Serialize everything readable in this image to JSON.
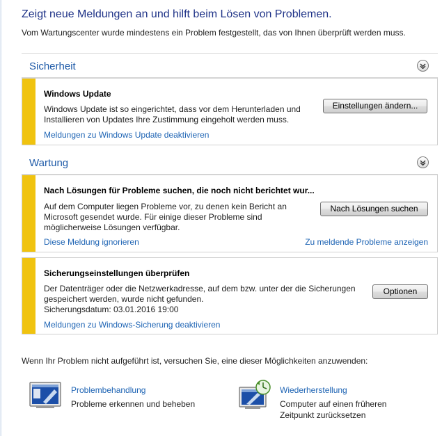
{
  "header": {
    "title": "Zeigt neue Meldungen an und hilft beim Lösen von Problemen.",
    "subtitle": "Vom Wartungscenter wurde mindestens ein Problem festgestellt, das von Ihnen überprüft werden muss."
  },
  "sections": {
    "security": {
      "title": "Sicherheit",
      "cards": [
        {
          "title": "Windows Update",
          "text": "Windows Update ist so eingerichtet, dass vor dem Herunterladen und Installieren von Updates Ihre Zustimmung eingeholt werden muss.",
          "button": "Einstellungen ändern...",
          "link": "Meldungen zu Windows Update deaktivieren"
        }
      ]
    },
    "maintenance": {
      "title": "Wartung",
      "cards": [
        {
          "title": "Nach Lösungen für Probleme suchen, die noch nicht berichtet wur...",
          "text": "Auf dem Computer liegen Probleme vor, zu denen kein Bericht an Microsoft gesendet wurde. Für einige dieser Probleme sind möglicherweise Lösungen verfügbar.",
          "button": "Nach Lösungen suchen",
          "link_left": "Diese Meldung ignorieren",
          "link_right": "Zu meldende Probleme anzeigen"
        },
        {
          "title": "Sicherungseinstellungen überprüfen",
          "text": "Der Datenträger oder die Netzwerkadresse, auf dem bzw. unter der die Sicherungen gespeichert werden, wurde nicht gefunden.",
          "backup_date": "Sicherungsdatum: 03.01.2016 19:00",
          "button": "Optionen",
          "link": "Meldungen zu Windows-Sicherung deaktivieren"
        }
      ]
    }
  },
  "footer": {
    "hint": "Wenn Ihr Problem nicht aufgeführt ist, versuchen Sie, eine dieser Möglichkeiten anzuwenden:",
    "options": [
      {
        "icon": "troubleshooting-icon",
        "link": "Problembehandlung",
        "description": "Probleme erkennen und beheben"
      },
      {
        "icon": "system-restore-icon",
        "link": "Wiederherstellung",
        "description": "Computer auf einen früheren Zeitpunkt zurücksetzen"
      }
    ]
  },
  "colors": {
    "title": "#1e3287",
    "section_title": "#1e5aa8",
    "link": "#1e64b4",
    "warning_stripe": "#f0c30f"
  }
}
